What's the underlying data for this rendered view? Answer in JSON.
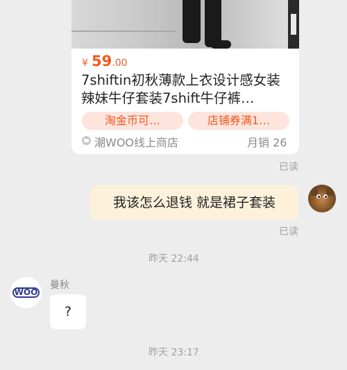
{
  "product_card": {
    "currency": "¥",
    "price_int": "59",
    "price_dec": ".00",
    "title": "7shiftin初秋薄款上衣设计感女装辣妹牛仔套装7shift牛仔裤…",
    "tags": [
      "淘金币可…",
      "店铺券满1…"
    ],
    "shop_icon": "shop-icon",
    "shop_name": "潮WOO线上商店",
    "monthly_sales": "月销 26"
  },
  "messages": {
    "read_status_1": "已读",
    "my_message": "我该怎么退钱 就是裙子套装",
    "read_status_2": "已读",
    "timestamp_1": "昨天 22:44",
    "sender_name": "曼秋",
    "other_avatar_logo": "WOO",
    "other_message": "?",
    "timestamp_2": "昨天 23:17"
  },
  "colors": {
    "accent": "#f25a1d",
    "tag_bg": "#fde4dc",
    "my_bubble": "#fdf1db",
    "page_bg": "#ededed"
  }
}
